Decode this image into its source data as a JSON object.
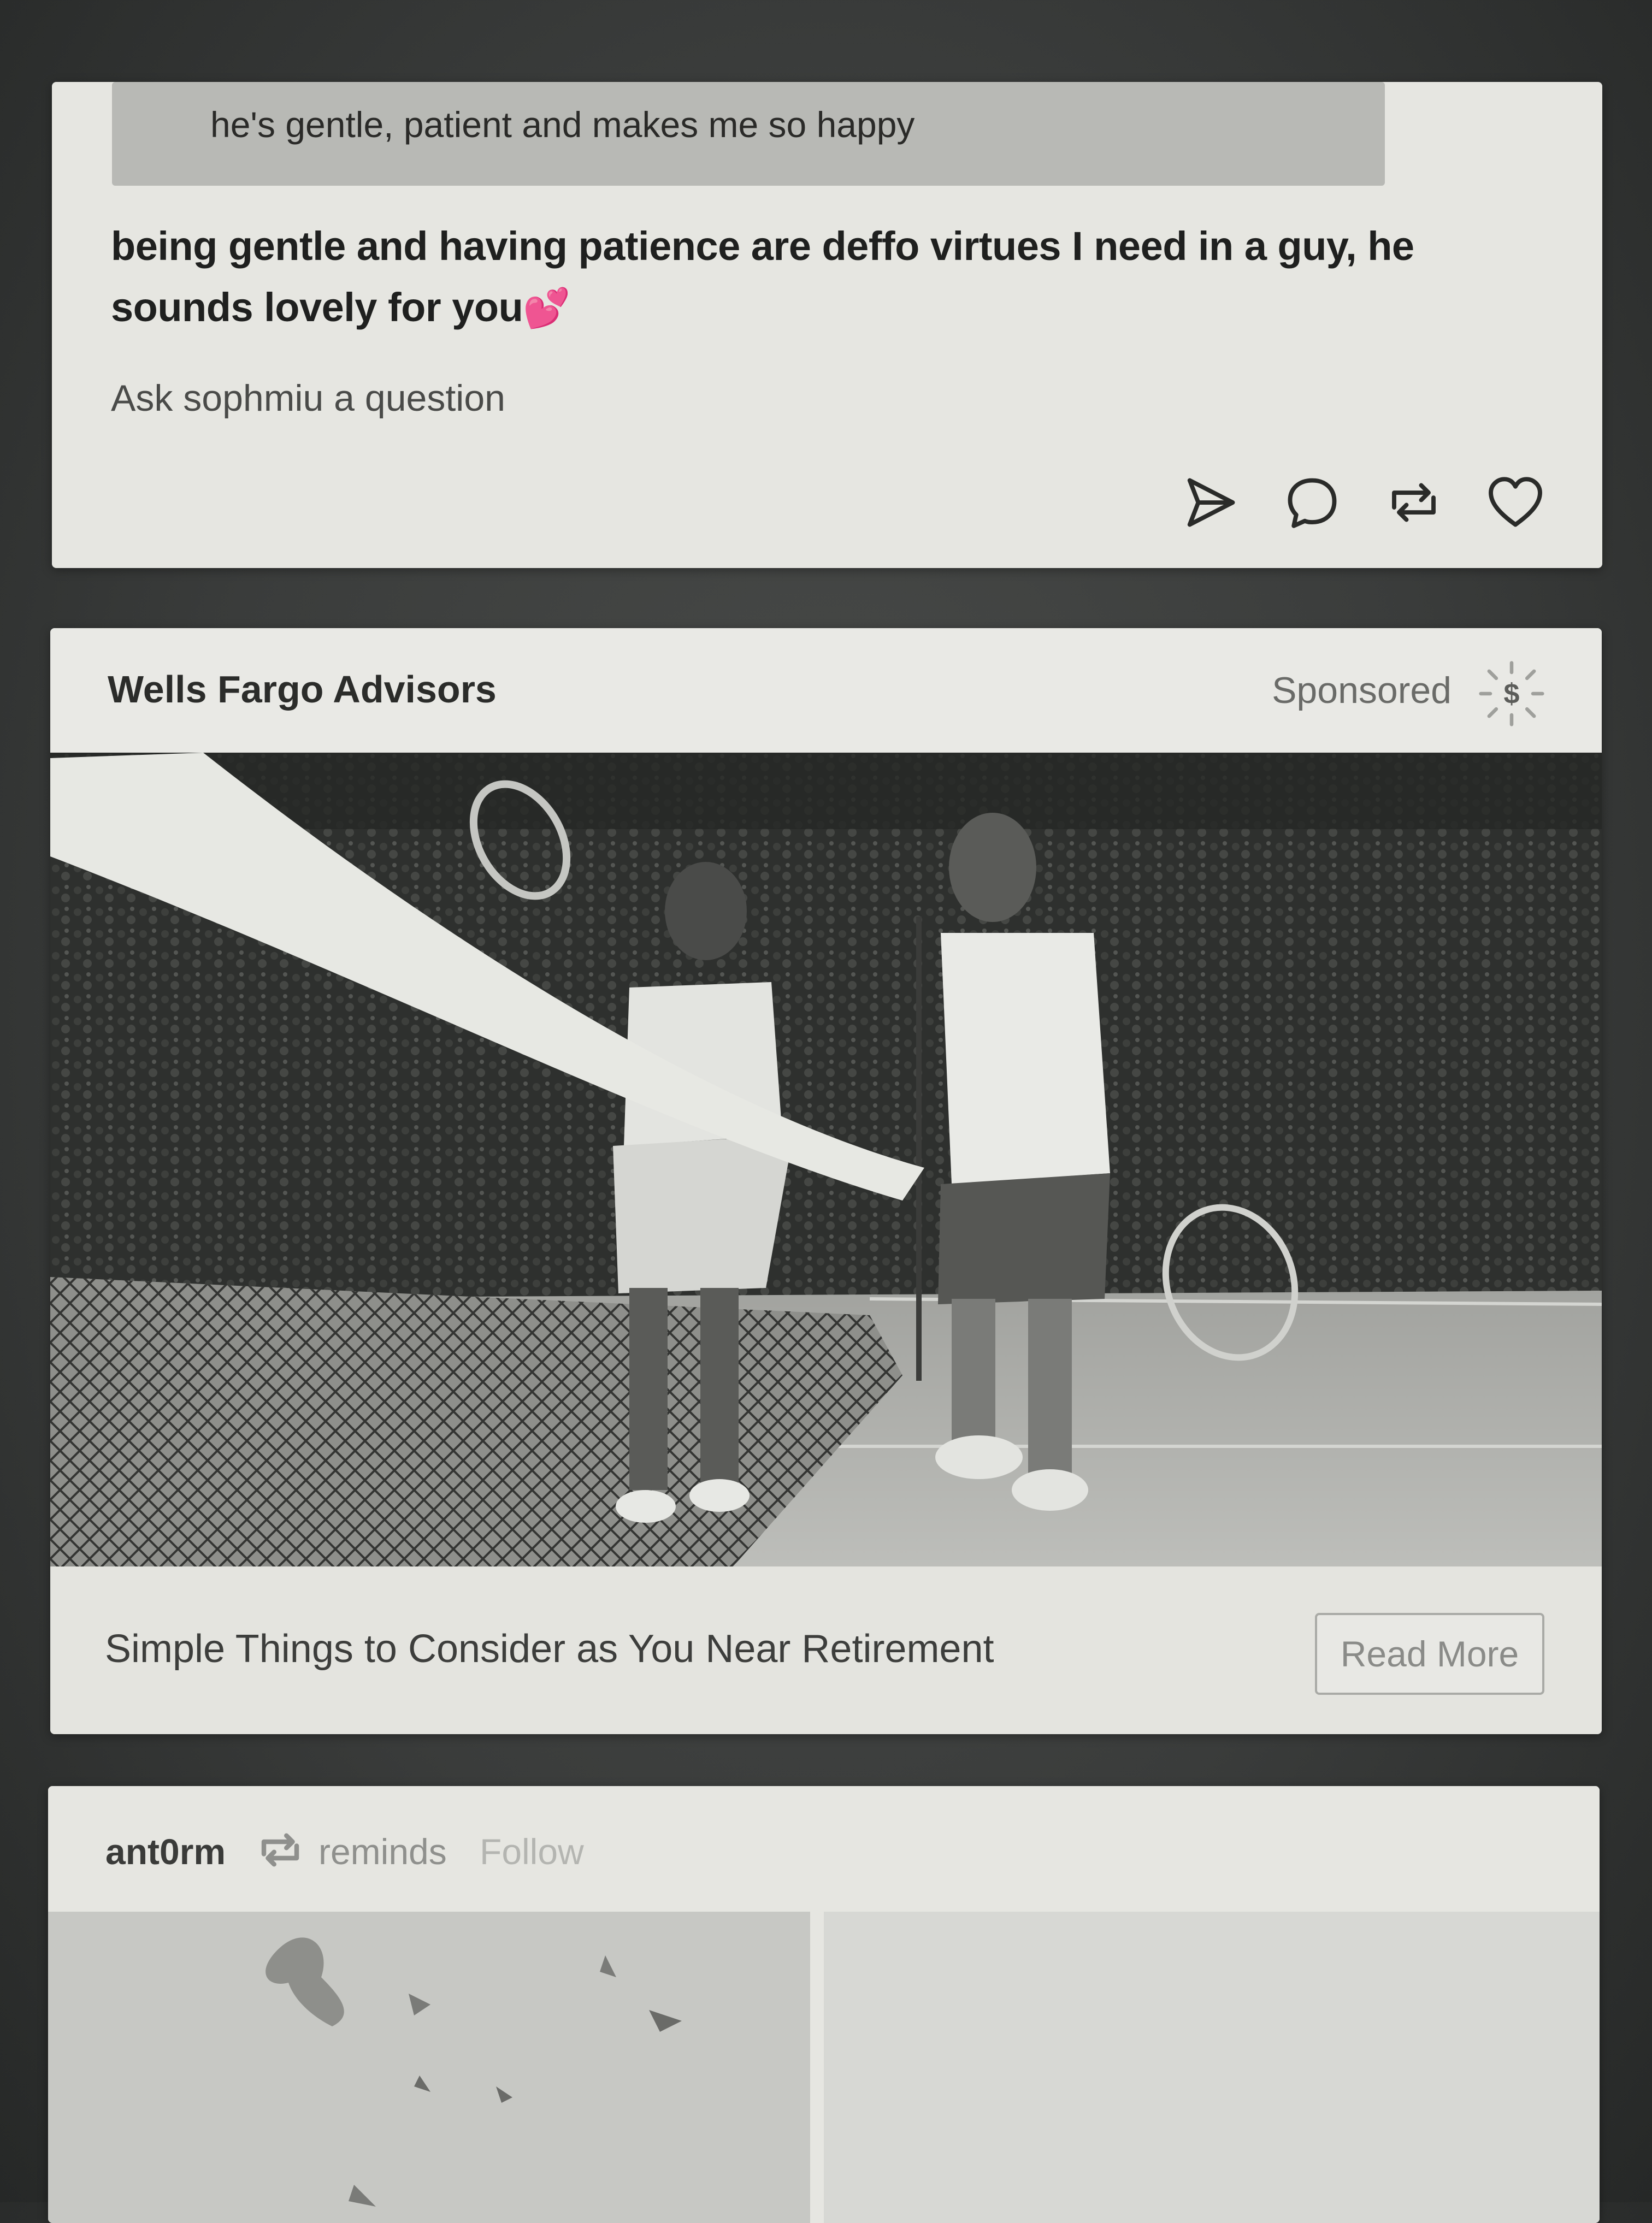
{
  "ask_post": {
    "question_text": "he's gentle, patient and makes me so happy",
    "answer_text": "being gentle and having patience are deffo virtues I need in a guy, he sounds lovely for you",
    "answer_emoji": "💕",
    "ask_link": "Ask sophmiu a question",
    "actions": [
      "share-icon",
      "reply-icon",
      "reblog-icon",
      "like-icon"
    ]
  },
  "ad_post": {
    "advertiser": "Wells Fargo Advisors",
    "sponsored_label": "Sponsored",
    "badge_symbol": "$",
    "headline": "Simple Things to Consider as You Near Retirement",
    "cta_label": "Read More"
  },
  "reblog_post": {
    "username": "ant0rm",
    "source": "reminds",
    "follow_label": "Follow"
  }
}
